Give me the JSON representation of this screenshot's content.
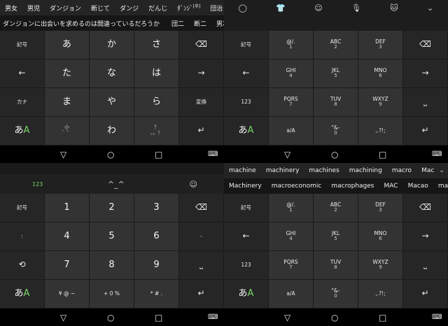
{
  "tl": {
    "suggestions1": [
      "男女",
      "男児",
      "ダンジョン",
      "断じて",
      "ダンジ",
      "だんじ",
      "ﾀﾞﾝｼﾞ",
      "団治"
    ],
    "suggestions1_sup": "[半]",
    "more": "⌄",
    "suggestions2": [
      "ダンジョンに出会いを求めるのは間違っているだろうか",
      "団二",
      "断二",
      "男次"
    ],
    "keys": {
      "r1": [
        "記号",
        "あ",
        "か",
        "さ",
        "⌫"
      ],
      "r2": [
        "←",
        "た",
        "な",
        "は",
        "→"
      ],
      "r3": [
        "カナ",
        "ま",
        "や",
        "ら",
        "変換"
      ],
      "r4_left": "あA",
      "r4_1_top": "小",
      "r4_1_bot": "゛゜",
      "r4_2": "わ",
      "r4_3_top": "？",
      "r4_3_bot": "、。！",
      "r4_enter": "↵"
    },
    "nav": [
      "▽",
      "○",
      "□",
      "⌨"
    ]
  },
  "tr": {
    "toolbar": [
      "◯",
      "👕",
      "☺",
      "🎙",
      "🐱",
      "⌄"
    ],
    "keys": {
      "r1_left": "記号",
      "r1": [
        {
          "t": "@/.",
          "n": "1"
        },
        {
          "t": "ABC",
          "n": "2"
        },
        {
          "t": "DEF",
          "n": "3"
        }
      ],
      "r1_right": "⌫",
      "r2_left": "←",
      "r2": [
        {
          "t": "GHI",
          "n": "4"
        },
        {
          "t": "JKL",
          "n": "5"
        },
        {
          "t": "MNO",
          "n": "6"
        }
      ],
      "r2_right": "→",
      "r3_left": "123",
      "r3": [
        {
          "t": "PQRS",
          "n": "7"
        },
        {
          "t": "TUV",
          "n": "8"
        },
        {
          "t": "WXYZ",
          "n": "9"
        }
      ],
      "r3_right": "⎵",
      "r4_left": "あA",
      "r4": [
        {
          "t": "a/A",
          "n": ""
        },
        {
          "t": "\"&-",
          "n": "0"
        },
        {
          "t": ",.?!;",
          "n": ""
        }
      ],
      "r4_right": "↵"
    },
    "nav": [
      "▽",
      "○",
      "□",
      "⌨"
    ]
  },
  "bl": {
    "toolbar": [
      "123",
      "^_^",
      "☺"
    ],
    "keys": {
      "r1": [
        "記号",
        "1",
        "2",
        "3",
        "⌫"
      ],
      "r2": [
        ":",
        "4",
        "5",
        "6",
        "-"
      ],
      "r3": [
        "⟲",
        "7",
        "8",
        "9",
        "⎵"
      ],
      "r4_left": "あA",
      "r4_1": "¥ @ ~",
      "r4_2": "+ 0 %",
      "r4_3": "* # .",
      "r4_enter": "↵"
    },
    "nav": [
      "▽",
      "○",
      "□",
      "⌨"
    ]
  },
  "br": {
    "suggestions1": [
      "machine",
      "machinery",
      "machines",
      "machining",
      "macro",
      "Mac"
    ],
    "more": "⌄",
    "suggestions2": [
      "Machinery",
      "macroeconomic",
      "macrophages",
      "MAC",
      "Macao",
      "macroscopic"
    ],
    "keys": {
      "r1_left": "記号",
      "r1": [
        {
          "t": "@/.",
          "n": "1"
        },
        {
          "t": "ABC",
          "n": "2"
        },
        {
          "t": "DEF",
          "n": "3"
        }
      ],
      "r1_right": "⌫",
      "r2_left": "←",
      "r2": [
        {
          "t": "GHI",
          "n": "4"
        },
        {
          "t": "JKL",
          "n": "5"
        },
        {
          "t": "MNO",
          "n": "6"
        }
      ],
      "r2_right": "→",
      "r3_left": "123",
      "r3": [
        {
          "t": "PQRS",
          "n": "7"
        },
        {
          "t": "TUV",
          "n": "8"
        },
        {
          "t": "WXYZ",
          "n": "9"
        }
      ],
      "r3_right": "⎵",
      "r4_left": "あA",
      "r4": [
        {
          "t": "a/A",
          "n": ""
        },
        {
          "t": "\"&-",
          "n": "0"
        },
        {
          "t": ",.?!;",
          "n": ""
        }
      ],
      "r4_right": "↵"
    },
    "nav": [
      "▽",
      "○",
      "□",
      "⌨"
    ]
  },
  "colors": {
    "accent": "#7bd86a",
    "key_main": "#333333",
    "key_side": "#262626",
    "nav": "#000000"
  }
}
